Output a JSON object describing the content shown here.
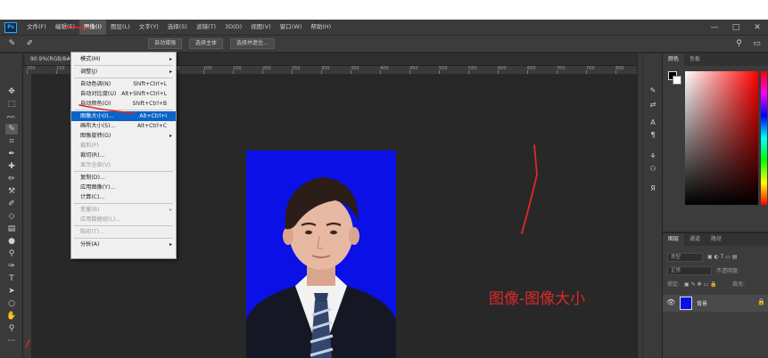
{
  "menubar": {
    "logo": "Ps",
    "items": [
      "文件(F)",
      "编辑(E)",
      "图像(I)",
      "图层(L)",
      "文字(Y)",
      "选择(S)",
      "滤镜(T)",
      "3D(D)",
      "视图(V)",
      "窗口(W)",
      "帮助(H)"
    ],
    "active_index": 2,
    "window_controls": [
      "—",
      "□",
      "✕"
    ]
  },
  "options_bar": {
    "buttons": [
      "自动增强",
      "选择主体",
      "选择并遮住..."
    ]
  },
  "document": {
    "tab_label": "90.9%(RGB/8#)",
    "ruler_ticks": [
      "200",
      "150",
      "100",
      "50",
      "0",
      "50",
      "100",
      "150",
      "200",
      "250",
      "300",
      "350",
      "400",
      "450",
      "500",
      "550",
      "600",
      "650",
      "700",
      "750",
      "800"
    ]
  },
  "image_menu": {
    "items": [
      {
        "label": "模式(M)",
        "shortcut": "",
        "submenu": true,
        "disabled": false,
        "highlight": false
      },
      {
        "sep": true
      },
      {
        "label": "调整(J)",
        "shortcut": "",
        "submenu": true,
        "disabled": false,
        "highlight": false
      },
      {
        "sep": true
      },
      {
        "label": "自动色调(N)",
        "shortcut": "Shift+Ctrl+L",
        "submenu": false,
        "disabled": false,
        "highlight": false
      },
      {
        "label": "自动对比度(U)",
        "shortcut": "Alt+Shift+Ctrl+L",
        "submenu": false,
        "disabled": false,
        "highlight": false
      },
      {
        "label": "自动颜色(O)",
        "shortcut": "Shift+Ctrl+B",
        "submenu": false,
        "disabled": false,
        "highlight": false
      },
      {
        "sep": true
      },
      {
        "label": "图像大小(I)...",
        "shortcut": "Alt+Ctrl+I",
        "submenu": false,
        "disabled": false,
        "highlight": true
      },
      {
        "label": "画布大小(S)...",
        "shortcut": "Alt+Ctrl+C",
        "submenu": false,
        "disabled": false,
        "highlight": false
      },
      {
        "label": "图像旋转(G)",
        "shortcut": "",
        "submenu": true,
        "disabled": false,
        "highlight": false
      },
      {
        "label": "裁剪(P)",
        "shortcut": "",
        "submenu": false,
        "disabled": true,
        "highlight": false
      },
      {
        "label": "裁切(R)...",
        "shortcut": "",
        "submenu": false,
        "disabled": false,
        "highlight": false
      },
      {
        "label": "显示全部(V)",
        "shortcut": "",
        "submenu": false,
        "disabled": true,
        "highlight": false
      },
      {
        "sep": true
      },
      {
        "label": "复制(D)...",
        "shortcut": "",
        "submenu": false,
        "disabled": false,
        "highlight": false
      },
      {
        "label": "应用图像(Y)...",
        "shortcut": "",
        "submenu": false,
        "disabled": false,
        "highlight": false
      },
      {
        "label": "计算(C)...",
        "shortcut": "",
        "submenu": false,
        "disabled": false,
        "highlight": false
      },
      {
        "sep": true
      },
      {
        "label": "变量(B)",
        "shortcut": "",
        "submenu": true,
        "disabled": true,
        "highlight": false
      },
      {
        "label": "应用数据组(L)...",
        "shortcut": "",
        "submenu": false,
        "disabled": true,
        "highlight": false
      },
      {
        "sep": true
      },
      {
        "label": "陷印(T)...",
        "shortcut": "",
        "submenu": false,
        "disabled": true,
        "highlight": false
      },
      {
        "sep": true
      },
      {
        "label": "分析(A)",
        "shortcut": "",
        "submenu": true,
        "disabled": false,
        "highlight": false
      }
    ]
  },
  "color_panel": {
    "tabs": [
      "颜色",
      "色板"
    ]
  },
  "layers_panel": {
    "tabs": [
      "图层",
      "通道",
      "路径"
    ],
    "filter_label": "类型",
    "blend_mode": "正常",
    "opacity_label": "不透明度:",
    "lock_label": "锁定:",
    "fill_label": "填充:",
    "layer_name": "背景"
  },
  "annotation": {
    "text": "图像-图像大小",
    "color": "#e02828"
  },
  "colors": {
    "photo_background": "#0a10e6",
    "menu_highlight": "#0a64c8"
  }
}
